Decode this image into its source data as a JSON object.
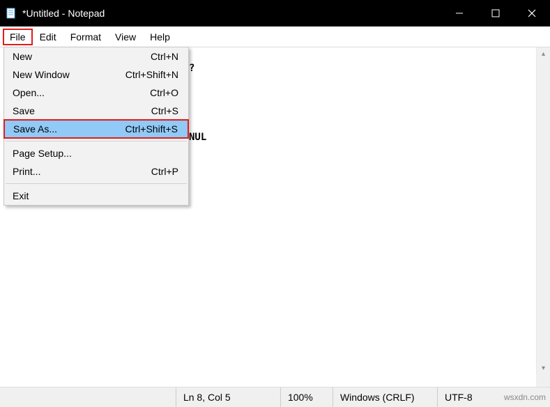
{
  "titlebar": {
    "title": "*Untitled - Notepad"
  },
  "menubar": {
    "file": "File",
    "edit": "Edit",
    "format": "Format",
    "view": "View",
    "help": "Help"
  },
  "dropdown": {
    "new": {
      "label": "New",
      "shortcut": "Ctrl+N"
    },
    "newwindow": {
      "label": "New Window",
      "shortcut": "Ctrl+Shift+N"
    },
    "open": {
      "label": "Open...",
      "shortcut": "Ctrl+O"
    },
    "save": {
      "label": "Save",
      "shortcut": "Ctrl+S"
    },
    "saveas": {
      "label": "Save As...",
      "shortcut": "Ctrl+Shift+S"
    },
    "pagesetup": {
      "label": "Page Setup...",
      "shortcut": ""
    },
    "print": {
      "label": "Print...",
      "shortcut": "Ctrl+P"
    },
    "exit": {
      "label": "Exit",
      "shortcut": ""
    }
  },
  "content": {
    "fragment1": "?",
    "fragment2": "NUL"
  },
  "statusbar": {
    "position": "Ln 8, Col 5",
    "zoom": "100%",
    "lineending": "Windows (CRLF)",
    "encoding": "UTF-8",
    "watermark": "wsxdn.com"
  }
}
